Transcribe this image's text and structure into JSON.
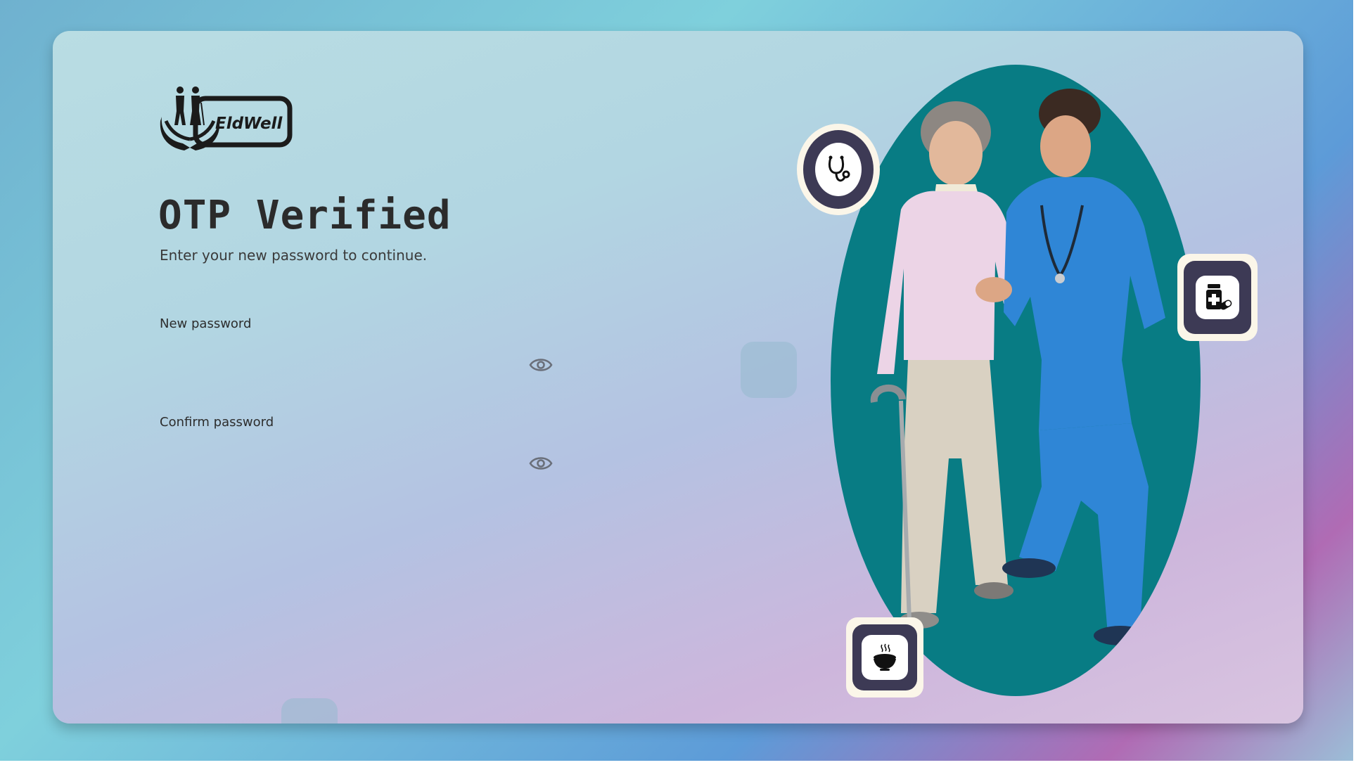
{
  "brand": {
    "name": "EldWell"
  },
  "page": {
    "title": "OTP Verified",
    "subtitle": "Enter your new password to continue."
  },
  "form": {
    "new_password": {
      "label": "New password",
      "value": "",
      "visibility_icon": "eye-icon"
    },
    "confirm_password": {
      "label": "Confirm password",
      "value": "",
      "visibility_icon": "eye-icon"
    }
  },
  "illustration": {
    "description_icons": [
      "stethoscope-icon",
      "medicine-bottle-icon",
      "food-bowl-icon"
    ]
  },
  "colors": {
    "oval_bg": "#087c84",
    "badge_dark": "#3d3a55",
    "badge_frame": "#fbf6e9",
    "scrubs": "#2f86d6"
  }
}
